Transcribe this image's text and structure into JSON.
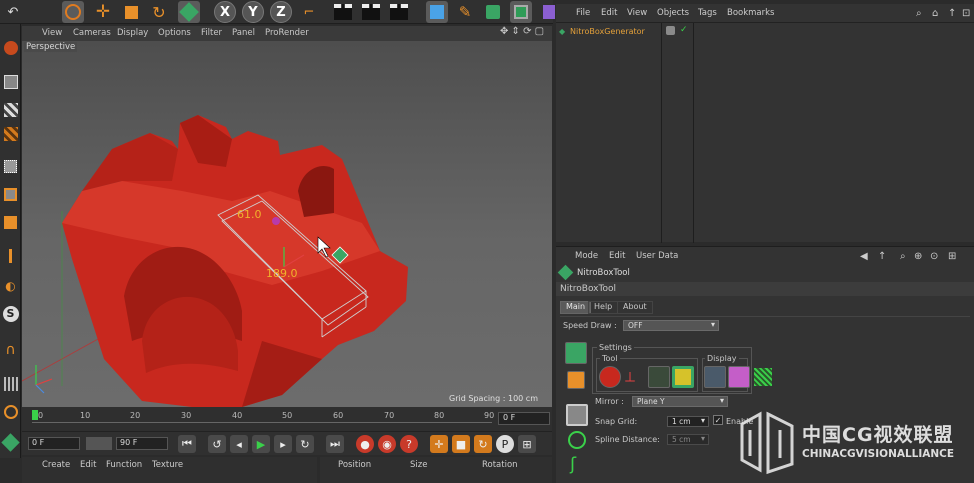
{
  "viewport": {
    "menu": [
      "View",
      "Cameras",
      "Display",
      "Options",
      "Filter",
      "Panel",
      "ProRender"
    ],
    "label": "Perspective",
    "grid_spacing": "Grid Spacing : 100 cm",
    "hud_length": "61.0",
    "hud_width": "189.0"
  },
  "toolbar": {
    "axis_x": "X",
    "axis_y": "Y",
    "axis_z": "Z"
  },
  "timeline": {
    "ticks": [
      "0",
      "10",
      "20",
      "30",
      "40",
      "50",
      "60",
      "70",
      "80",
      "90"
    ],
    "end_frame": "0 F",
    "current_frame": "0 F",
    "max_frame": "90 F"
  },
  "material_bar": {
    "items": [
      "Create",
      "Edit",
      "Function",
      "Texture"
    ]
  },
  "coord_bar": {
    "items": [
      "Position",
      "Size",
      "Rotation"
    ]
  },
  "object_manager": {
    "menu": [
      "File",
      "Edit",
      "View",
      "Objects",
      "Tags",
      "Bookmarks"
    ],
    "object_name": "NitroBoxGenerator"
  },
  "attribute_manager": {
    "menu": [
      "Mode",
      "Edit",
      "User Data"
    ],
    "tool_title": "NitroBoxTool",
    "tool_subtitle": "NitroBoxTool",
    "tabs": [
      "Main",
      "Help",
      "About"
    ],
    "speed_draw_label": "Speed Draw :",
    "speed_draw_value": "OFF",
    "settings_label": "Settings",
    "tool_group_label": "Tool",
    "display_group_label": "Display",
    "mirror_label": "Mirror :",
    "mirror_value": "Plane Y",
    "snap_grid_label": "Snap Grid:",
    "snap_grid_value": "1 cm",
    "enable_label": "Enable",
    "spline_distance_label": "Spline Distance:",
    "spline_distance_value": "5 cm"
  },
  "watermark": {
    "line1": "中国CG视效联盟",
    "line2": "CHINACGVISIONALLIANCE"
  },
  "colors": {
    "model_red": "#c8281e",
    "accent_orange": "#e3a03a",
    "selection_green": "#2ec25c"
  }
}
